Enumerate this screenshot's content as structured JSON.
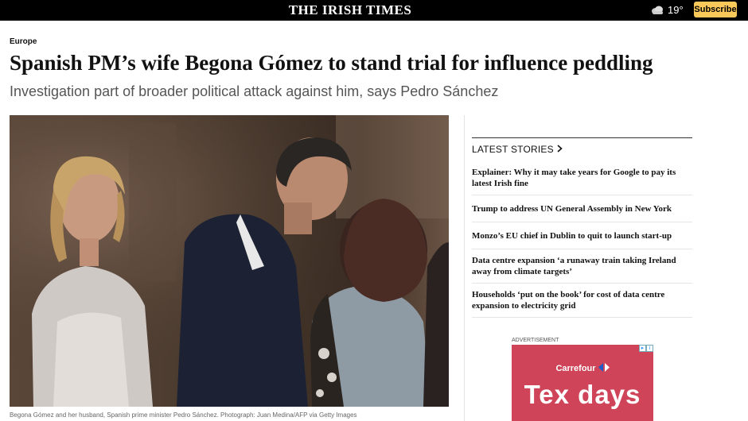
{
  "header": {
    "masthead": "THE IRISH TIMES",
    "weather": {
      "icon": "cloud-icon",
      "temperature": "19°"
    },
    "subscribe_label": "Subscribe"
  },
  "article": {
    "section": "Europe",
    "headline": "Spanish PM’s wife Begona Gómez to stand trial for influence peddling",
    "standfirst": "Investigation part of broader political attack against him, says Pedro Sánchez",
    "image_caption": "Begona Gómez and her husband, Spanish prime minister Pedro Sánchez. Photograph: Juan Medina/AFP via Getty Images"
  },
  "sidebar": {
    "latest_title": "LATEST STORIES",
    "stories": [
      "Explainer: Why it may take years for Google to pay its latest Irish fine",
      "Trump to address UN General Assembly in New York",
      "Monzo’s EU chief in Dublin to quit to launch start-up",
      "Data centre expansion ‘a runaway train taking Ireland away from climate targets’",
      "Households ‘put on the book’ for cost of data centre expansion to electricity grid"
    ]
  },
  "ad": {
    "label": "ADVERTISEMENT",
    "brand": "Carrefour",
    "text": "Tex days"
  },
  "colors": {
    "topbar": "#000000",
    "subscribe": "#fbc95a",
    "ad_background": "#cf4459",
    "standfirst": "#555555"
  }
}
